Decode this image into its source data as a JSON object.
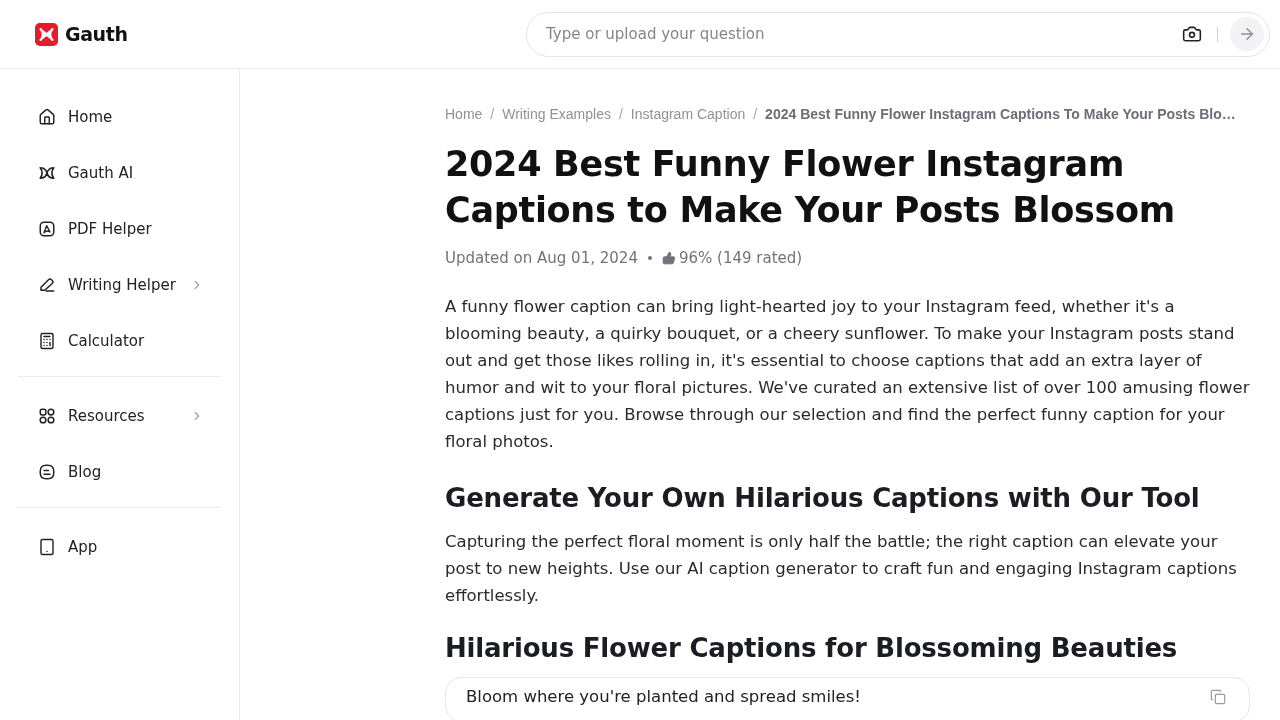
{
  "header": {
    "logo": "Gauth",
    "search": {
      "placeholder": "Type or upload your question"
    }
  },
  "sidebar": {
    "sections": [
      {
        "items": [
          {
            "label": "Home",
            "expandable": false
          },
          {
            "label": "Gauth AI",
            "expandable": false
          },
          {
            "label": "PDF Helper",
            "expandable": false
          },
          {
            "label": "Writing Helper",
            "expandable": true
          },
          {
            "label": "Calculator",
            "expandable": false
          }
        ]
      },
      {
        "items": [
          {
            "label": "Resources",
            "expandable": true
          },
          {
            "label": "Blog",
            "expandable": false
          }
        ]
      },
      {
        "items": [
          {
            "label": "App",
            "expandable": false
          }
        ]
      }
    ]
  },
  "article": {
    "breadcrumb": {
      "separators": [
        "/",
        "/",
        "/"
      ],
      "items": [
        {
          "label": "Home",
          "current": false
        },
        {
          "label": "Writing Examples",
          "current": false
        },
        {
          "label": "Instagram Caption",
          "current": false
        },
        {
          "label": "2024 Best Funny Flower Instagram Captions To Make Your Posts Blo…",
          "current": true
        }
      ]
    },
    "title": "2024 Best Funny Flower Instagram Captions to Make Your Posts Blossom",
    "meta": {
      "updated": "Updated on Aug 01, 2024",
      "rating": "96% (149 rated)"
    },
    "intro": "A funny flower caption can bring light-hearted joy to your Instagram feed, whether it's a blooming beauty, a quirky bouquet, or a cheery sunflower. To make your Instagram posts stand out and get those likes rolling in, it's essential to choose captions that add an extra layer of humor and wit to your floral pictures. We've curated an extensive list of over 100 amusing flower captions just for you. Browse through our selection and find the perfect funny caption for your floral photos.",
    "sections": [
      {
        "heading": "Generate Your Own Hilarious Captions with Our Tool",
        "body": "Capturing the perfect floral moment is only half the battle; the right caption can elevate your post to new heights. Use our AI caption generator to craft fun and engaging Instagram captions effortlessly."
      },
      {
        "heading": "Hilarious Flower Captions for Blossoming Beauties",
        "captions": [
          {
            "text": "Bloom where you're planted and spread smiles!"
          }
        ]
      }
    ]
  }
}
